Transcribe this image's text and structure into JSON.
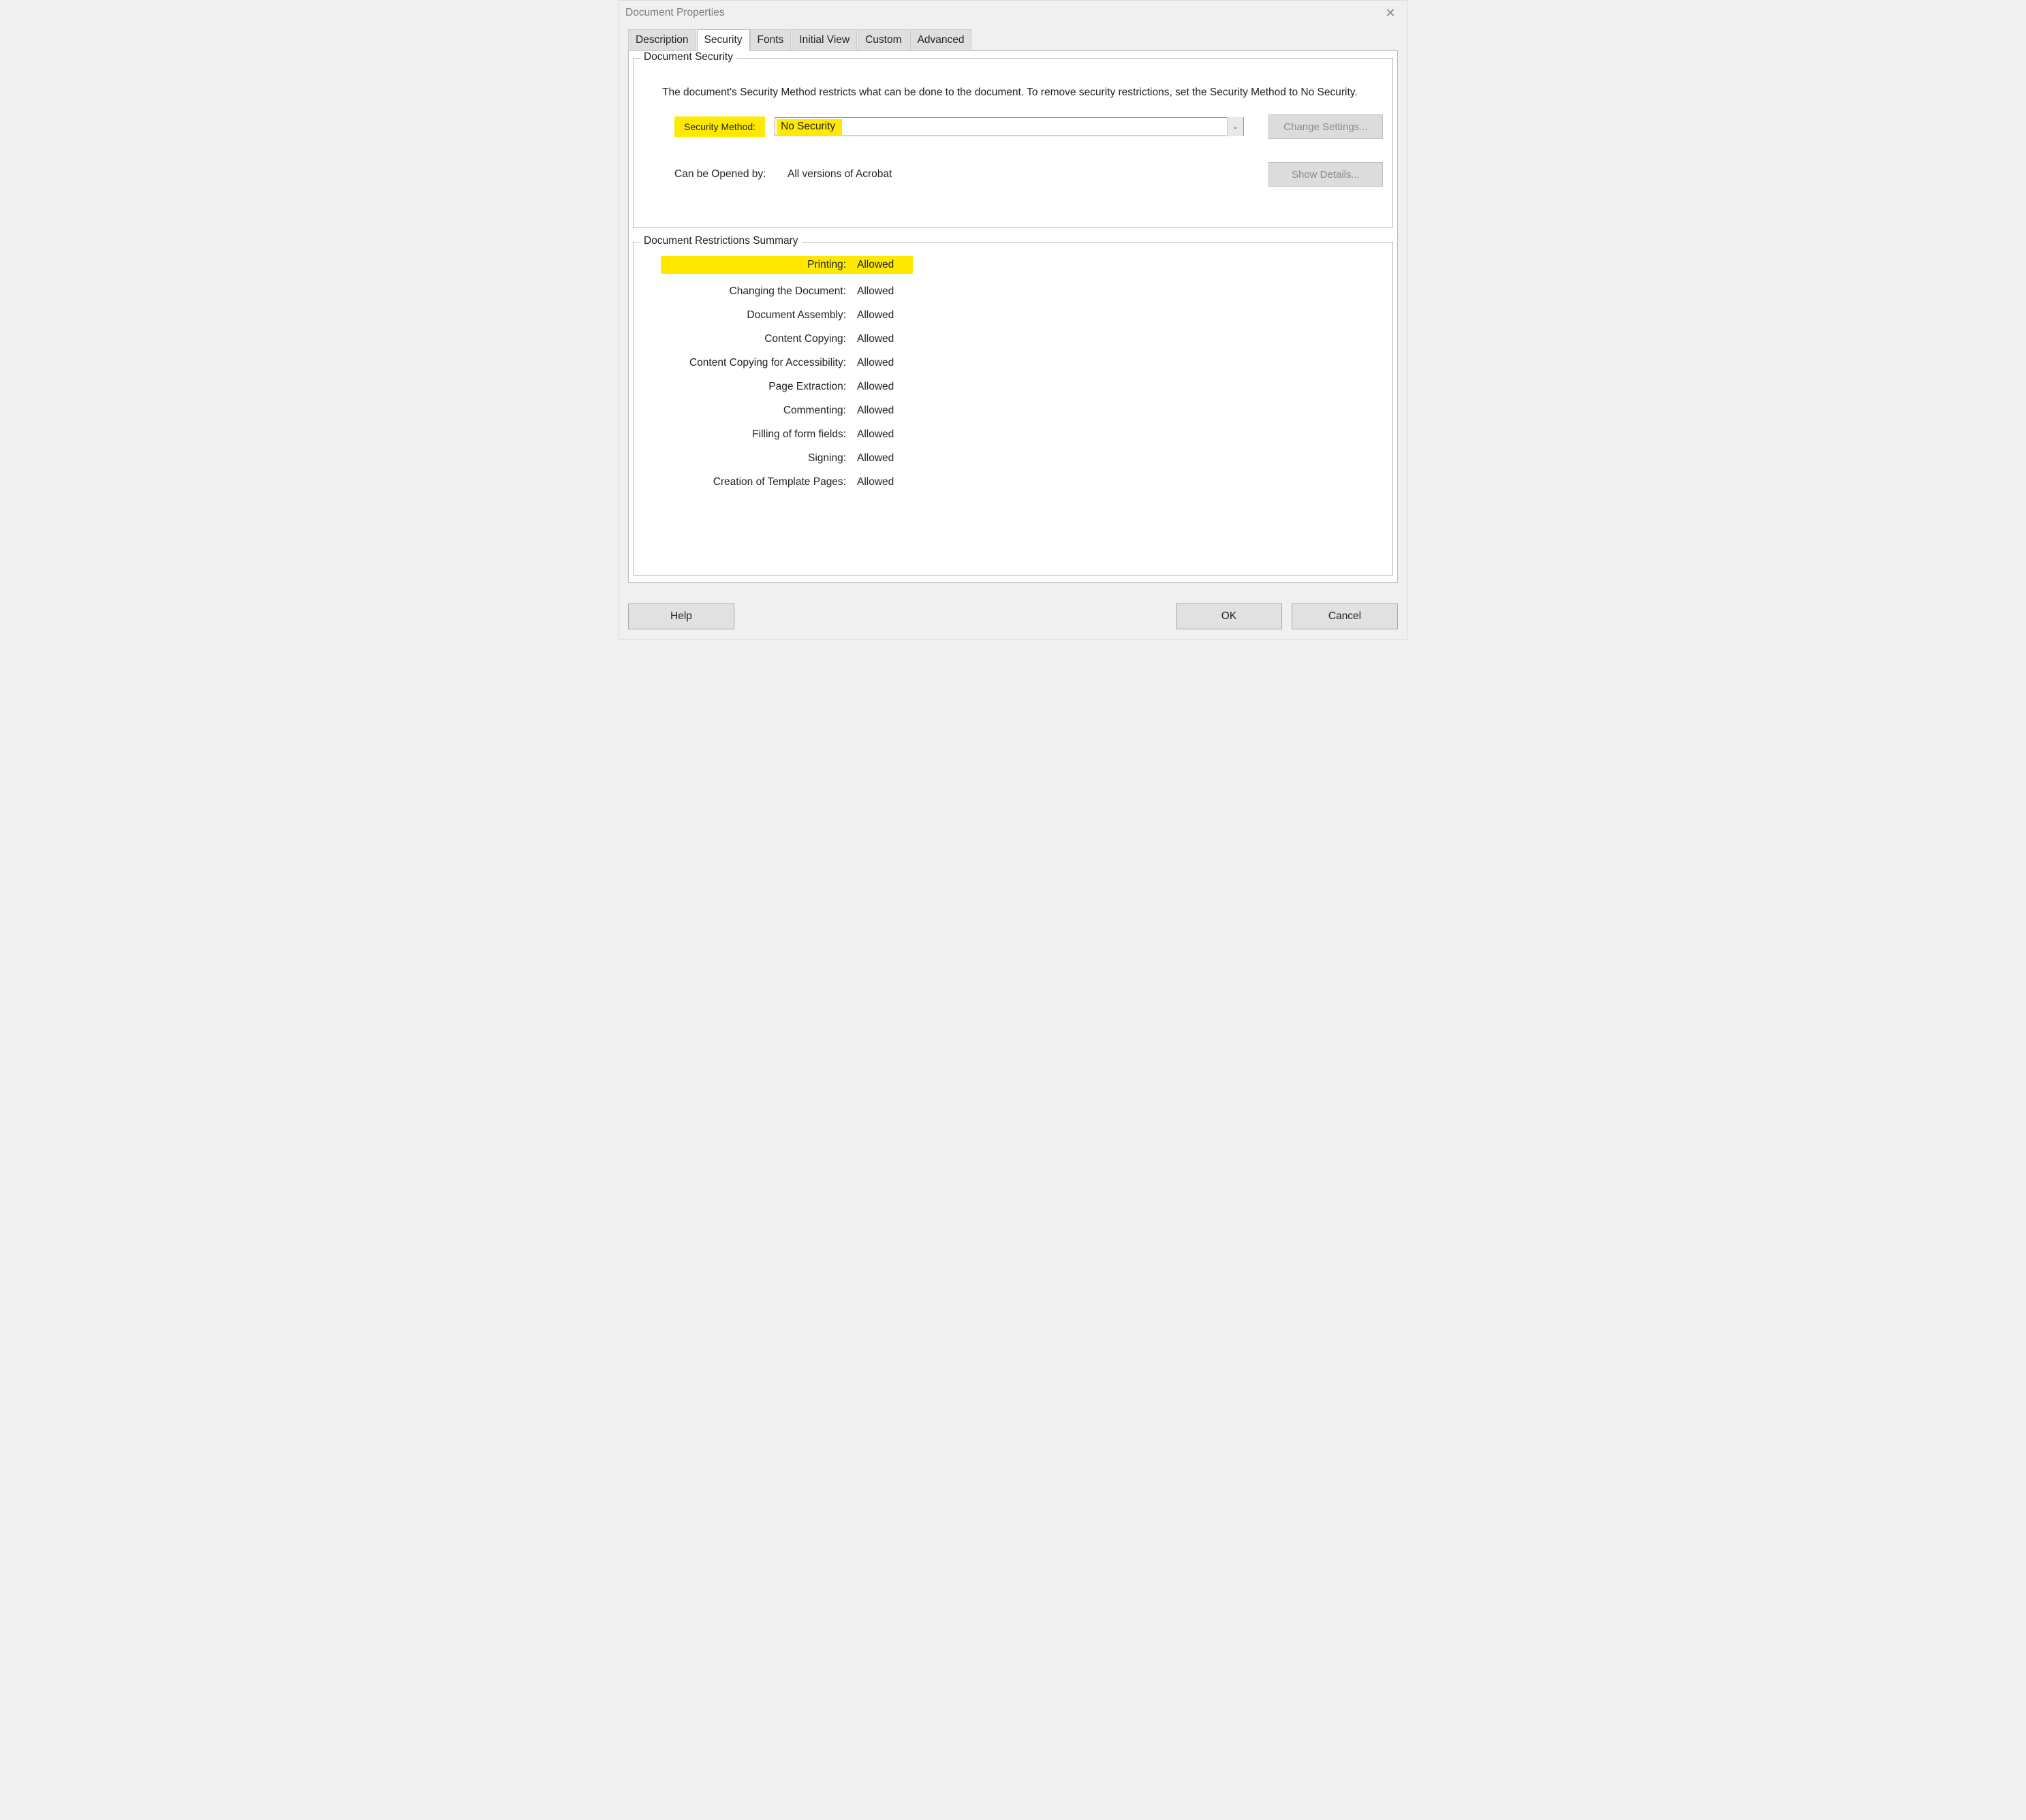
{
  "window": {
    "title": "Document Properties"
  },
  "tabs": {
    "description": "Description",
    "security": "Security",
    "fonts": "Fonts",
    "initial_view": "Initial View",
    "custom": "Custom",
    "advanced": "Advanced"
  },
  "security": {
    "group_title": "Document Security",
    "instructions": "The document's Security Method restricts what can be done to the document. To remove security restrictions, set the Security Method to No Security.",
    "method_label": "Security Method:",
    "method_value": "No Security",
    "change_settings": "Change Settings...",
    "can_open_label": "Can be Opened by:",
    "can_open_value": "All versions of Acrobat",
    "show_details": "Show Details..."
  },
  "restrictions": {
    "group_title": "Document Restrictions Summary",
    "items": [
      {
        "label": "Printing:",
        "value": "Allowed",
        "highlight": true
      },
      {
        "label": "Changing the Document:",
        "value": "Allowed"
      },
      {
        "label": "Document Assembly:",
        "value": "Allowed"
      },
      {
        "label": "Content Copying:",
        "value": "Allowed"
      },
      {
        "label": "Content Copying for Accessibility:",
        "value": "Allowed"
      },
      {
        "label": "Page Extraction:",
        "value": "Allowed"
      },
      {
        "label": "Commenting:",
        "value": "Allowed"
      },
      {
        "label": "Filling of form fields:",
        "value": "Allowed"
      },
      {
        "label": "Signing:",
        "value": "Allowed"
      },
      {
        "label": "Creation of Template Pages:",
        "value": "Allowed"
      }
    ]
  },
  "footer": {
    "help": "Help",
    "ok": "OK",
    "cancel": "Cancel"
  }
}
